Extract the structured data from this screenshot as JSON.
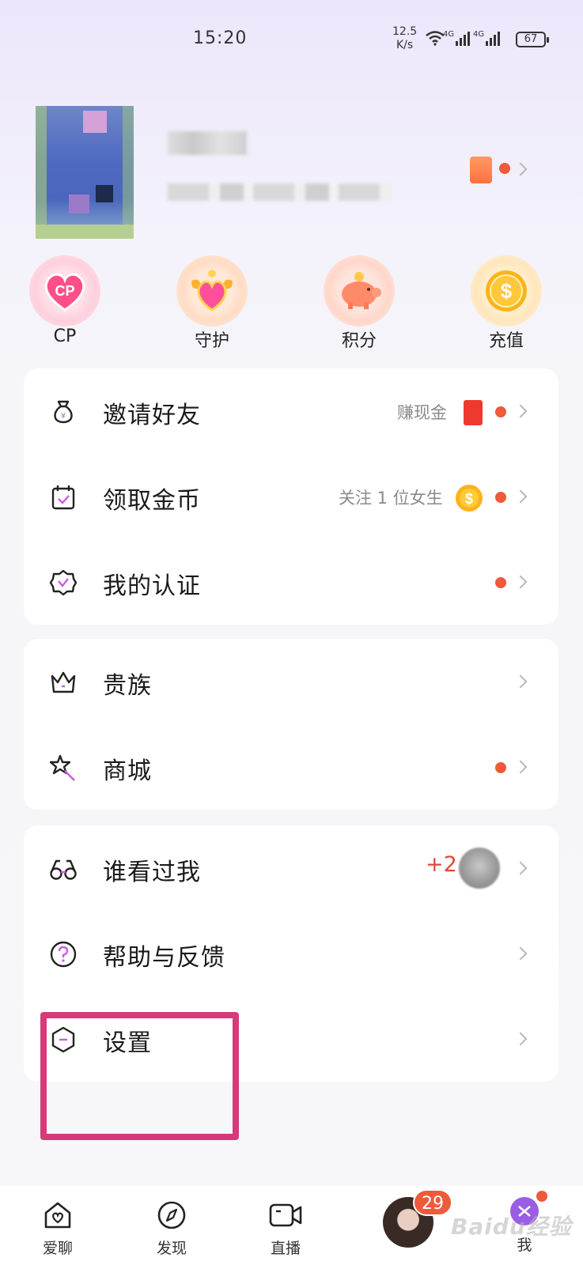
{
  "status_bar": {
    "time": "15:20",
    "net_speed_value": "12.5",
    "net_speed_unit": "K/s",
    "network_1": "4G",
    "network_2": "4G",
    "battery": "67"
  },
  "quick_actions": [
    {
      "label": "CP",
      "icon": "cp-heart-icon"
    },
    {
      "label": "守护",
      "icon": "guard-heart-icon"
    },
    {
      "label": "积分",
      "icon": "piggy-bank-icon"
    },
    {
      "label": "充值",
      "icon": "dollar-coin-icon"
    }
  ],
  "card1": {
    "rows": [
      {
        "title": "邀请好友",
        "sub": "赚现金",
        "icon": "money-bag-icon"
      },
      {
        "title": "领取金币",
        "sub": "关注 1 位女生",
        "icon": "calendar-check-icon"
      },
      {
        "title": "我的认证",
        "sub": "",
        "icon": "badge-check-icon"
      }
    ]
  },
  "card2": {
    "rows": [
      {
        "title": "贵族",
        "icon": "crown-icon"
      },
      {
        "title": "商城",
        "icon": "magic-wand-icon"
      }
    ]
  },
  "card3": {
    "rows": [
      {
        "title": "谁看过我",
        "count": "+2",
        "icon": "glasses-icon"
      },
      {
        "title": "帮助与反馈",
        "icon": "help-circle-icon"
      },
      {
        "title": "设置",
        "icon": "settings-hexagon-icon"
      }
    ]
  },
  "bottom_nav": {
    "items": [
      {
        "label": "爱聊",
        "icon": "home-heart-icon"
      },
      {
        "label": "发现",
        "icon": "compass-icon"
      },
      {
        "label": "直播",
        "icon": "video-camera-icon"
      },
      {
        "label": "我",
        "icon": "me-icon"
      }
    ],
    "badge": "29"
  },
  "watermark": "Baidu经验",
  "colors": {
    "accent_red": "#ee5a3a",
    "highlight": "#d63a7a",
    "purple": "#9b5de5"
  }
}
